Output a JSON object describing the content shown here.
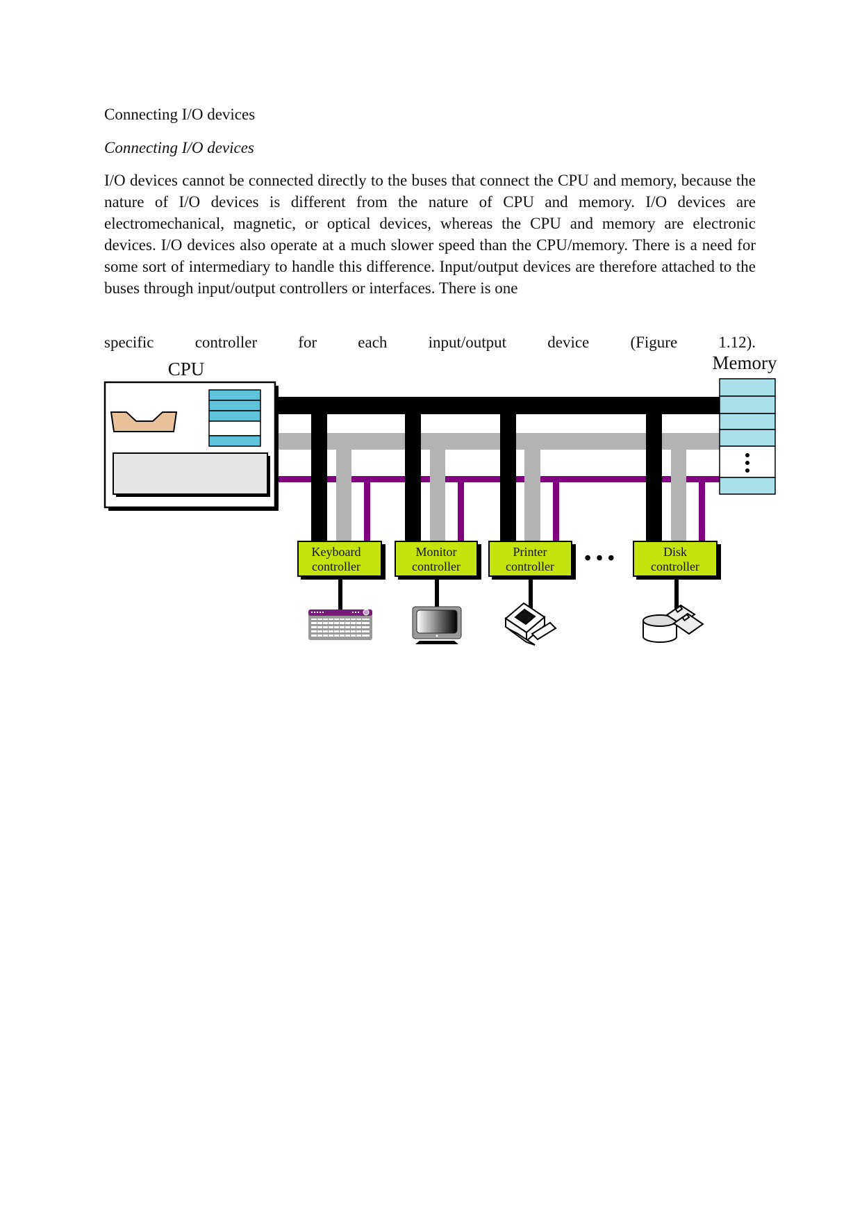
{
  "document": {
    "heading": "Connecting I/O devices",
    "subheading": "Connecting I/O devices",
    "paragraph": "I/O devices cannot be connected directly to the buses that connect the CPU and memory, because the nature of I/O devices is different from the nature of CPU and memory. I/O devices are electromechanical, magnetic, or optical devices, whereas the CPU and memory are electronic devices. I/O devices also operate at a much slower speed than the CPU/memory. There is a need for some sort of intermediary to handle this difference. Input/output devices are therefore attached to the buses through input/output controllers or interfaces. There is one",
    "paragraph_continuation": "specific controller for each input/output device (Figure 1.12)."
  },
  "figure": {
    "cpu_label": "CPU",
    "memory_label": "Memory",
    "ellipsis": "• • •",
    "memory_ellipsis": "⋮",
    "bus_colors": {
      "data_bus": "#000000",
      "address_bus": "#b3b3b3",
      "control_bus": "#800080"
    },
    "colors": {
      "controller_fill": "#c5e40d",
      "register_fill": "#5ec4da",
      "memory_fill": "#a9dfea",
      "alu_fill": "#e8c19a",
      "control_unit_fill": "#e5e5e5"
    },
    "controllers": [
      {
        "line1": "Keyboard",
        "line2": "controller",
        "device": "keyboard-icon"
      },
      {
        "line1": "Monitor",
        "line2": "controller",
        "device": "monitor-icon"
      },
      {
        "line1": "Printer",
        "line2": "controller",
        "device": "printer-icon"
      },
      {
        "line1": "Disk",
        "line2": "controller",
        "device": "disk-icon"
      }
    ]
  }
}
